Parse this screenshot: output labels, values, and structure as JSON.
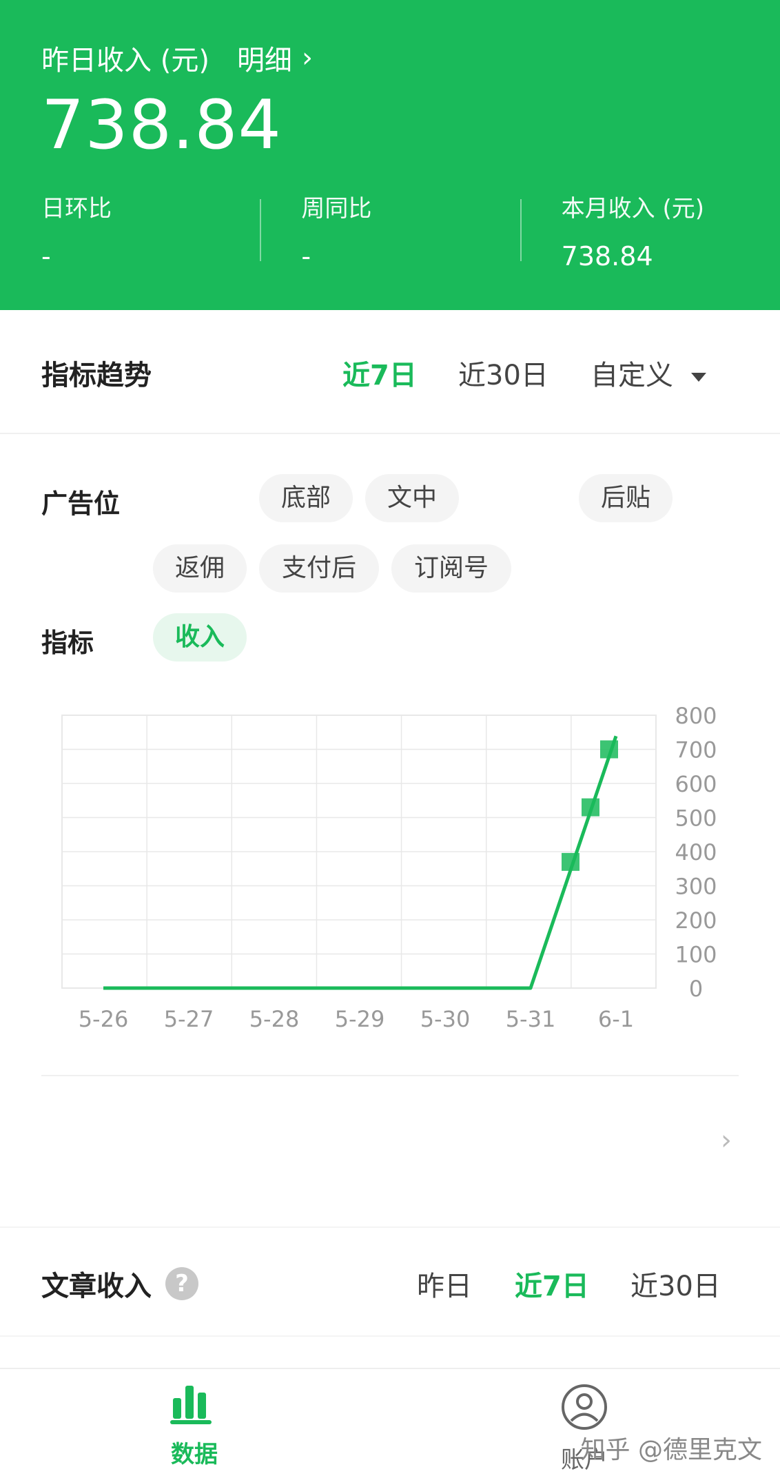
{
  "header": {
    "title": "昨日收入 (元)",
    "detail_link": "明细",
    "amount": "738.84",
    "stats": [
      {
        "label": "日环比",
        "value": "-"
      },
      {
        "label": "周同比",
        "value": "-"
      },
      {
        "label": "本月收入 (元)",
        "value": "738.84"
      }
    ]
  },
  "trend": {
    "title": "指标趋势",
    "ranges": [
      "近7日",
      "近30日",
      "自定义"
    ],
    "active_range": "近7日",
    "ad_slot_label": "广告位",
    "ad_slots": [
      "底部",
      "文中",
      "后贴",
      "返佣",
      "支付后",
      "订阅号"
    ],
    "metric_label": "指标",
    "metrics": [
      "收入"
    ]
  },
  "chart_data": {
    "type": "line",
    "categories": [
      "5-26",
      "5-27",
      "5-28",
      "5-29",
      "5-30",
      "5-31",
      "6-1"
    ],
    "series": [
      {
        "values": [
          0,
          0,
          0,
          0,
          0,
          0,
          738.84
        ]
      }
    ],
    "markers": [
      370,
      530,
      700
    ],
    "ylim": [
      0,
      800
    ],
    "yticks": [
      0,
      100,
      200,
      300,
      400,
      500,
      600,
      700,
      800
    ],
    "colors": {
      "line": "#1aba5a",
      "grid": "#e8e8e8",
      "tick": "#999999"
    }
  },
  "article": {
    "title": "文章收入",
    "ranges": [
      "昨日",
      "近7日",
      "近30日"
    ],
    "active_range": "近7日"
  },
  "nav": {
    "tabs": [
      {
        "label": "数据",
        "icon": "bar-chart-icon"
      },
      {
        "label": "账户",
        "icon": "user-circle-icon"
      }
    ],
    "watermark": "知乎 @德里克文"
  },
  "colors": {
    "brand": "#1aba5a",
    "brand_light": "#e7f7ed"
  }
}
